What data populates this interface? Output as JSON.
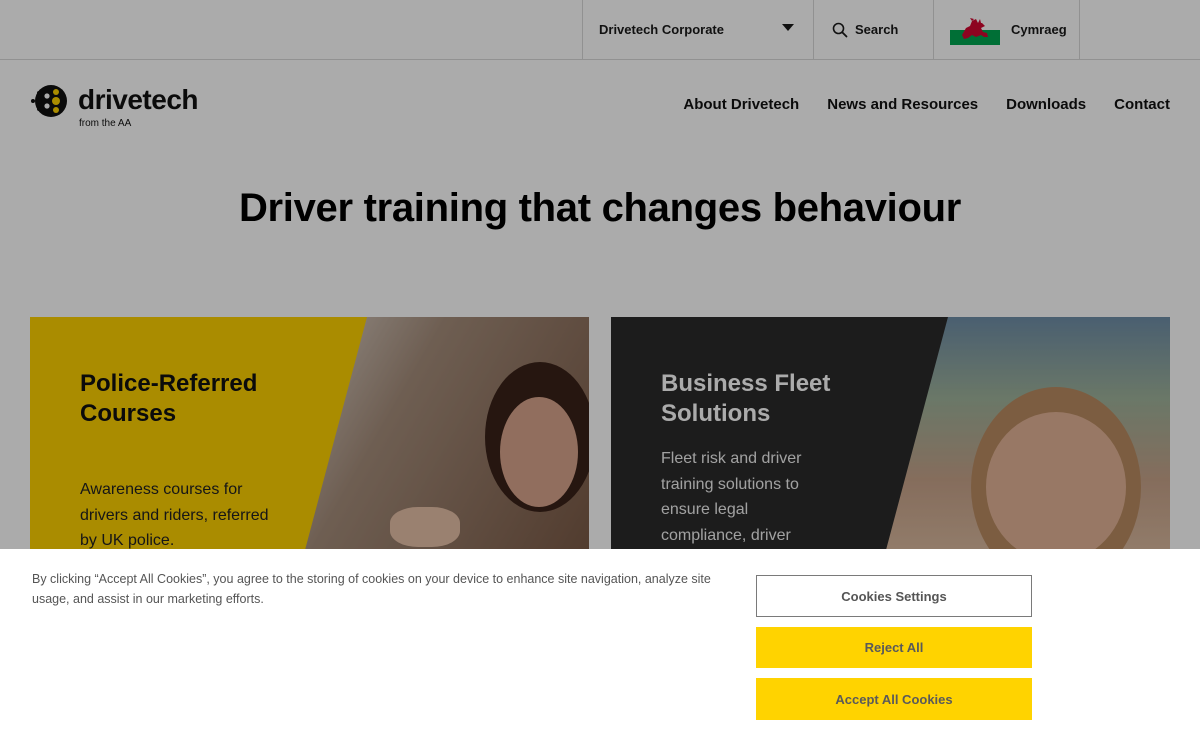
{
  "utility_bar": {
    "corporate_label": "Drivetech Corporate",
    "search_label": "Search",
    "language_label": "Cymraeg"
  },
  "logo": {
    "wordmark": "drivetech",
    "tagline": "from the AA"
  },
  "nav": {
    "items": [
      "About Drivetech",
      "News and Resources",
      "Downloads",
      "Contact"
    ]
  },
  "hero": {
    "title": "Driver training that changes behaviour"
  },
  "cards": [
    {
      "title": "Police-Referred Courses",
      "description": "Awareness courses for drivers and riders, referred by UK police."
    },
    {
      "title": "Business Fleet Solutions",
      "description": "Fleet risk and driver training solutions to ensure legal compliance, driver"
    }
  ],
  "cookie_banner": {
    "text": "By clicking “Accept All Cookies”, you agree to the storing of cookies on your device to enhance site navigation, analyze site usage, and assist in our marketing efforts.",
    "settings_label": "Cookies Settings",
    "reject_label": "Reject All",
    "accept_label": "Accept All Cookies"
  },
  "colors": {
    "brand_yellow": "#fed100",
    "dark_card": "#2b2b2b",
    "button_yellow": "#ffd300"
  },
  "icons": [
    "chevron-down-icon",
    "search-icon",
    "welsh-flag-icon",
    "drivetech-logo-icon"
  ]
}
